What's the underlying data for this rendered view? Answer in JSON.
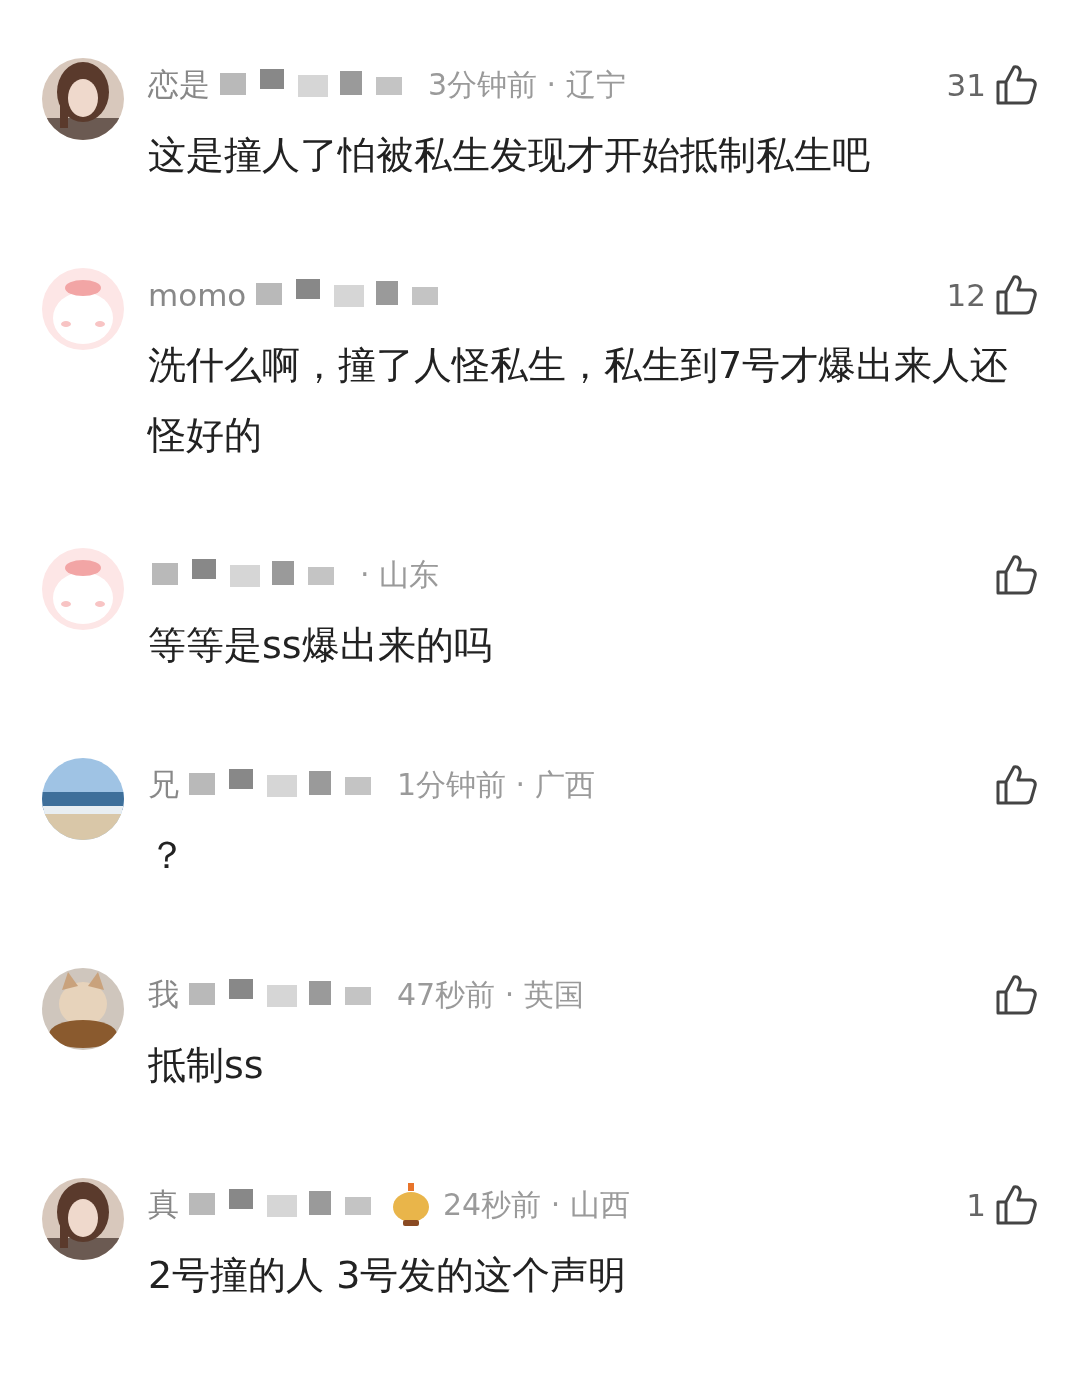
{
  "comments": [
    {
      "avatar": {
        "kind": "girl-photo"
      },
      "name": "恋是",
      "meta": "3分钟前 · 辽宁",
      "likes": "31",
      "text": "这是撞人了怕被私生发现才开始抵制私生吧"
    },
    {
      "avatar": {
        "kind": "cartoon"
      },
      "name": "momo",
      "likes": "12",
      "text": "洗什么啊，撞了人怪私生，私生到7号才爆出来人还怪好的"
    },
    {
      "avatar": {
        "kind": "cartoon"
      },
      "meta": "· 山东",
      "text": "等等是ss爆出来的吗"
    },
    {
      "avatar": {
        "kind": "sea"
      },
      "name": "兄",
      "meta": "1分钟前 · 广西",
      "text": "？"
    },
    {
      "avatar": {
        "kind": "cat"
      },
      "name": "我",
      "meta": "47秒前 · 英国",
      "text": "抵制ss"
    },
    {
      "avatar": {
        "kind": "girl-photo"
      },
      "name": "真",
      "badge": true,
      "meta": "24秒前 · 山西",
      "likes": "1",
      "text": "2号撞的人 3号发的这个声明"
    }
  ]
}
